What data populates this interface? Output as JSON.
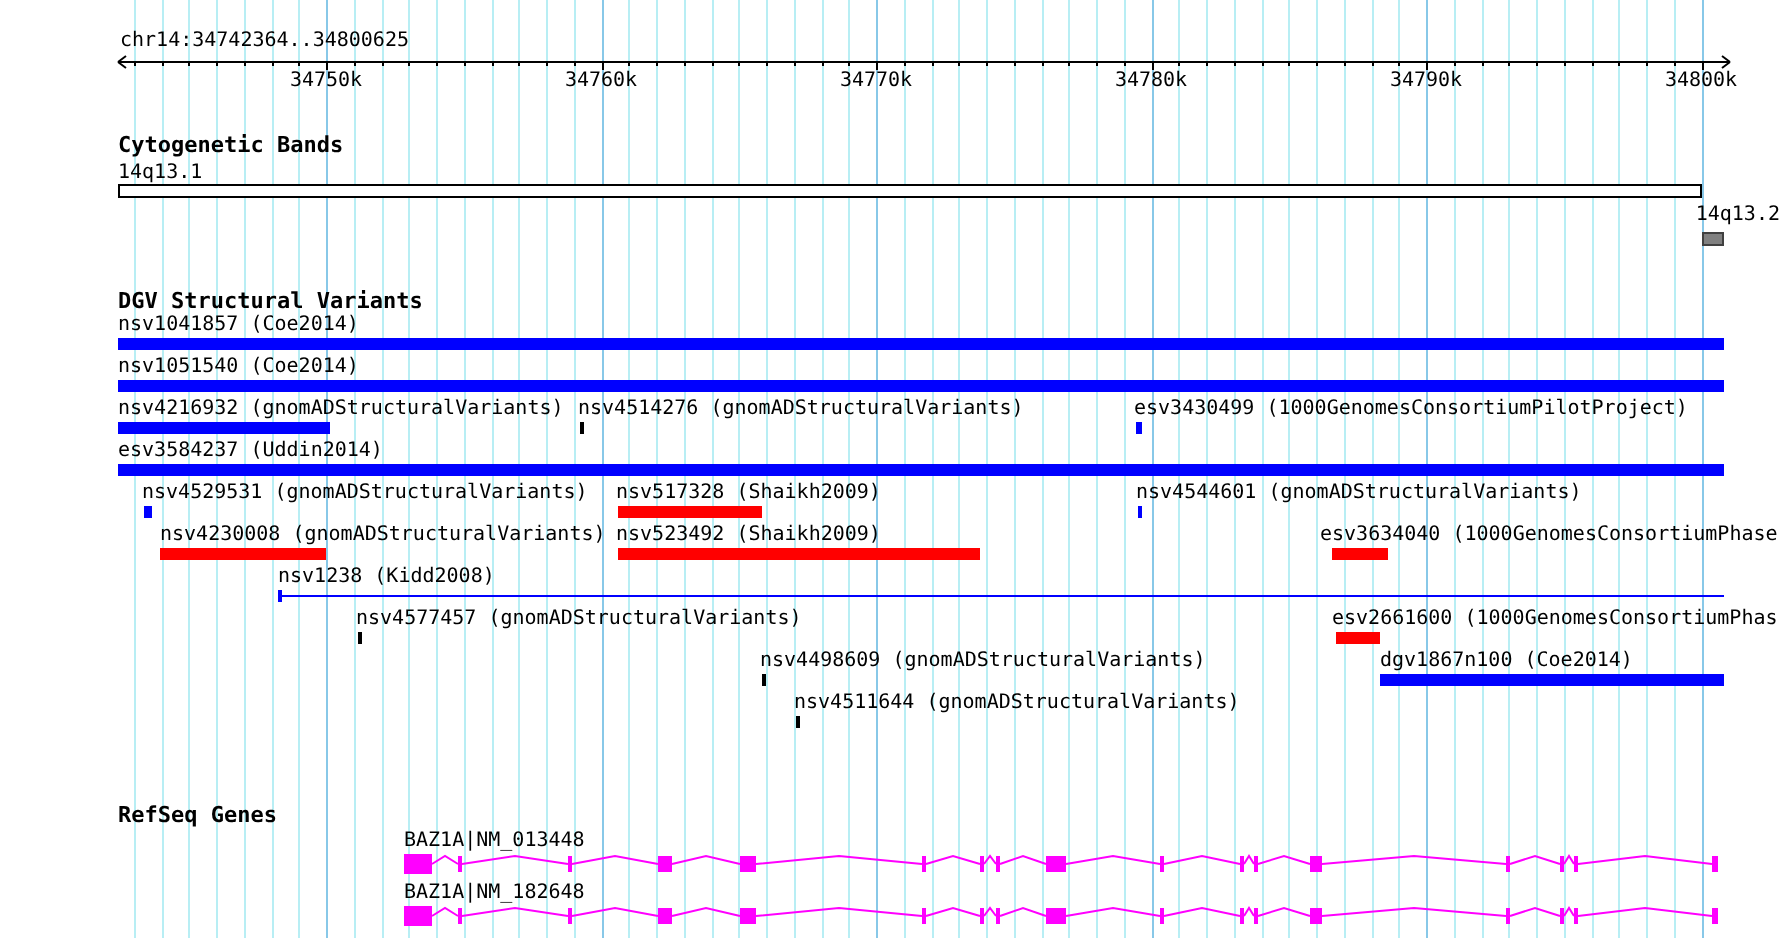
{
  "ruler": {
    "location": "chr14:34742364..34800625",
    "ticks": [
      "34750k",
      "34760k",
      "34770k",
      "34780k",
      "34790k",
      "34800k"
    ]
  },
  "cytogenetic_bands": {
    "title": "Cytogenetic Bands",
    "bands": [
      {
        "label": "14q13.1",
        "color": "#ffffff"
      },
      {
        "label": "14q13.2",
        "color": "#808080"
      }
    ]
  },
  "dgv_structural_variants": {
    "title": "DGV Structural Variants",
    "features": [
      {
        "label": "nsv1041857 (Coe2014)",
        "color": "#0000ff",
        "kind": "block"
      },
      {
        "label": "nsv1051540 (Coe2014)",
        "color": "#0000ff",
        "kind": "block"
      },
      {
        "label": "nsv4216932 (gnomADStructuralVariants)",
        "color": "#0000ff",
        "kind": "block"
      },
      {
        "label": "nsv4514276 (gnomADStructuralVariants)",
        "color": "#000000",
        "kind": "block"
      },
      {
        "label": "esv3430499 (1000GenomesConsortiumPilotProject)",
        "color": "#0000ff",
        "kind": "block"
      },
      {
        "label": "esv3584237 (Uddin2014)",
        "color": "#0000ff",
        "kind": "block"
      },
      {
        "label": "nsv4529531 (gnomADStructuralVariants)",
        "color": "#0000ff",
        "kind": "block"
      },
      {
        "label": "nsv517328 (Shaikh2009)",
        "color": "#ff0000",
        "kind": "block"
      },
      {
        "label": "nsv4544601 (gnomADStructuralVariants)",
        "color": "#0000ff",
        "kind": "block"
      },
      {
        "label": "nsv4230008 (gnomADStructuralVariants)",
        "color": "#ff0000",
        "kind": "block"
      },
      {
        "label": "nsv523492 (Shaikh2009)",
        "color": "#ff0000",
        "kind": "block"
      },
      {
        "label": "esv3634040 (1000GenomesConsortiumPhase",
        "color": "#ff0000",
        "kind": "block"
      },
      {
        "label": "nsv1238 (Kidd2008)",
        "color": "#0000ff",
        "kind": "span"
      },
      {
        "label": "nsv4577457 (gnomADStructuralVariants)",
        "color": "#000000",
        "kind": "block"
      },
      {
        "label": "esv2661600 (1000GenomesConsortiumPhas",
        "color": "#ff0000",
        "kind": "block"
      },
      {
        "label": "nsv4498609 (gnomADStructuralVariants)",
        "color": "#000000",
        "kind": "block"
      },
      {
        "label": "dgv1867n100 (Coe2014)",
        "color": "#0000ff",
        "kind": "block"
      },
      {
        "label": "nsv4511644 (gnomADStructuralVariants)",
        "color": "#000000",
        "kind": "block"
      }
    ]
  },
  "refseq_genes": {
    "title": "RefSeq Genes",
    "genes": [
      {
        "label": "BAZ1A|NM_013448"
      },
      {
        "label": "BAZ1A|NM_182648"
      }
    ]
  }
}
